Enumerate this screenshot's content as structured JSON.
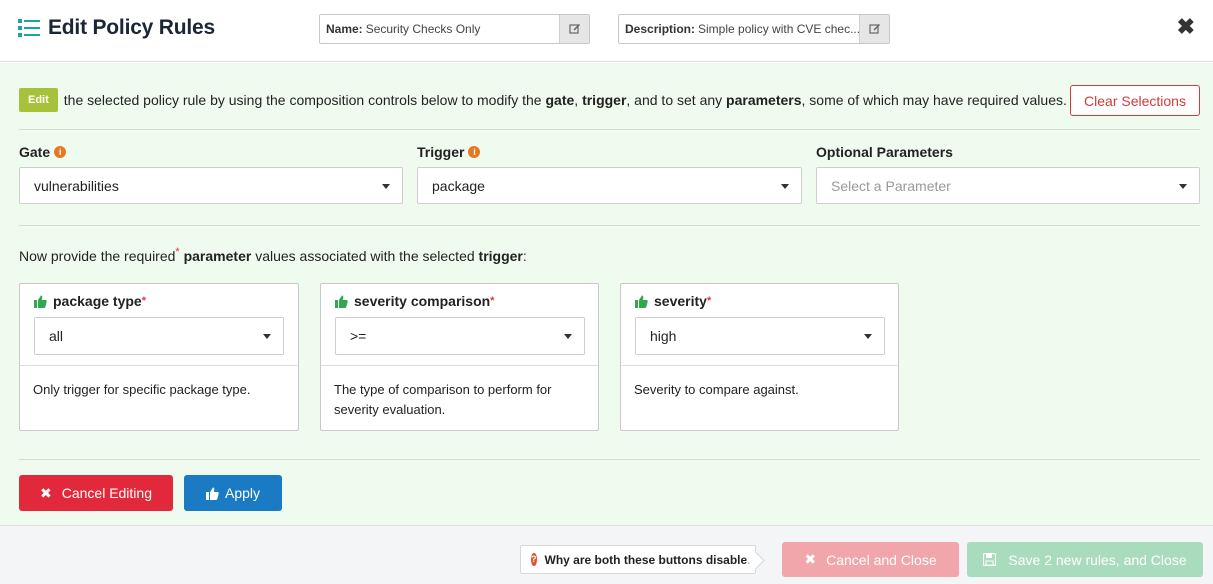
{
  "header": {
    "title": "Edit Policy Rules",
    "name_label": "Name:",
    "name_value": "Security Checks Only",
    "description_label": "Description:",
    "description_value": "Simple policy with CVE chec..."
  },
  "intro": {
    "badge": "Edit",
    "text_1": "the selected policy rule by using the composition controls below to modify the",
    "gate_word": "gate",
    "comma": ",",
    "trigger_word": "trigger",
    "text_2": ", and to set any",
    "parameters_word": "parameters",
    "text_3": ", some of which may have required values.",
    "clear_button": "Clear Selections"
  },
  "selectors": {
    "gate": {
      "label": "Gate",
      "value": "vulnerabilities"
    },
    "trigger": {
      "label": "Trigger",
      "value": "package"
    },
    "optional": {
      "label": "Optional Parameters",
      "placeholder": "Select a Parameter"
    }
  },
  "required": {
    "text_1": "Now provide the required",
    "star": "*",
    "parameter_word": "parameter",
    "text_2": "values associated with the selected",
    "trigger_word": "trigger",
    "colon": ":"
  },
  "params": [
    {
      "name": "package type",
      "value": "all",
      "description": "Only trigger for specific package type."
    },
    {
      "name": "severity comparison",
      "value": ">=",
      "description": "The type of comparison to perform for severity evaluation."
    },
    {
      "name": "severity",
      "value": "high",
      "description": "Severity to compare against."
    }
  ],
  "actions": {
    "cancel_editing": "Cancel Editing",
    "apply": "Apply"
  },
  "footer": {
    "why_text": "Why are both these buttons disabled?",
    "cancel_close": "Cancel and Close",
    "save_close": "Save 2 new rules, and Close"
  },
  "colors": {
    "edit_badge": "#a6c23a",
    "danger": "#e2293b",
    "primary": "#1a7bc4",
    "success_icon": "#2fa84f",
    "info": "#e87722",
    "panel_bg": "#f0fbf0"
  },
  "icons": [
    "list-icon",
    "edit-icon",
    "close-icon",
    "info-icon",
    "caret-down-icon",
    "thumbs-up-icon",
    "x-icon",
    "question-icon",
    "save-icon"
  ]
}
